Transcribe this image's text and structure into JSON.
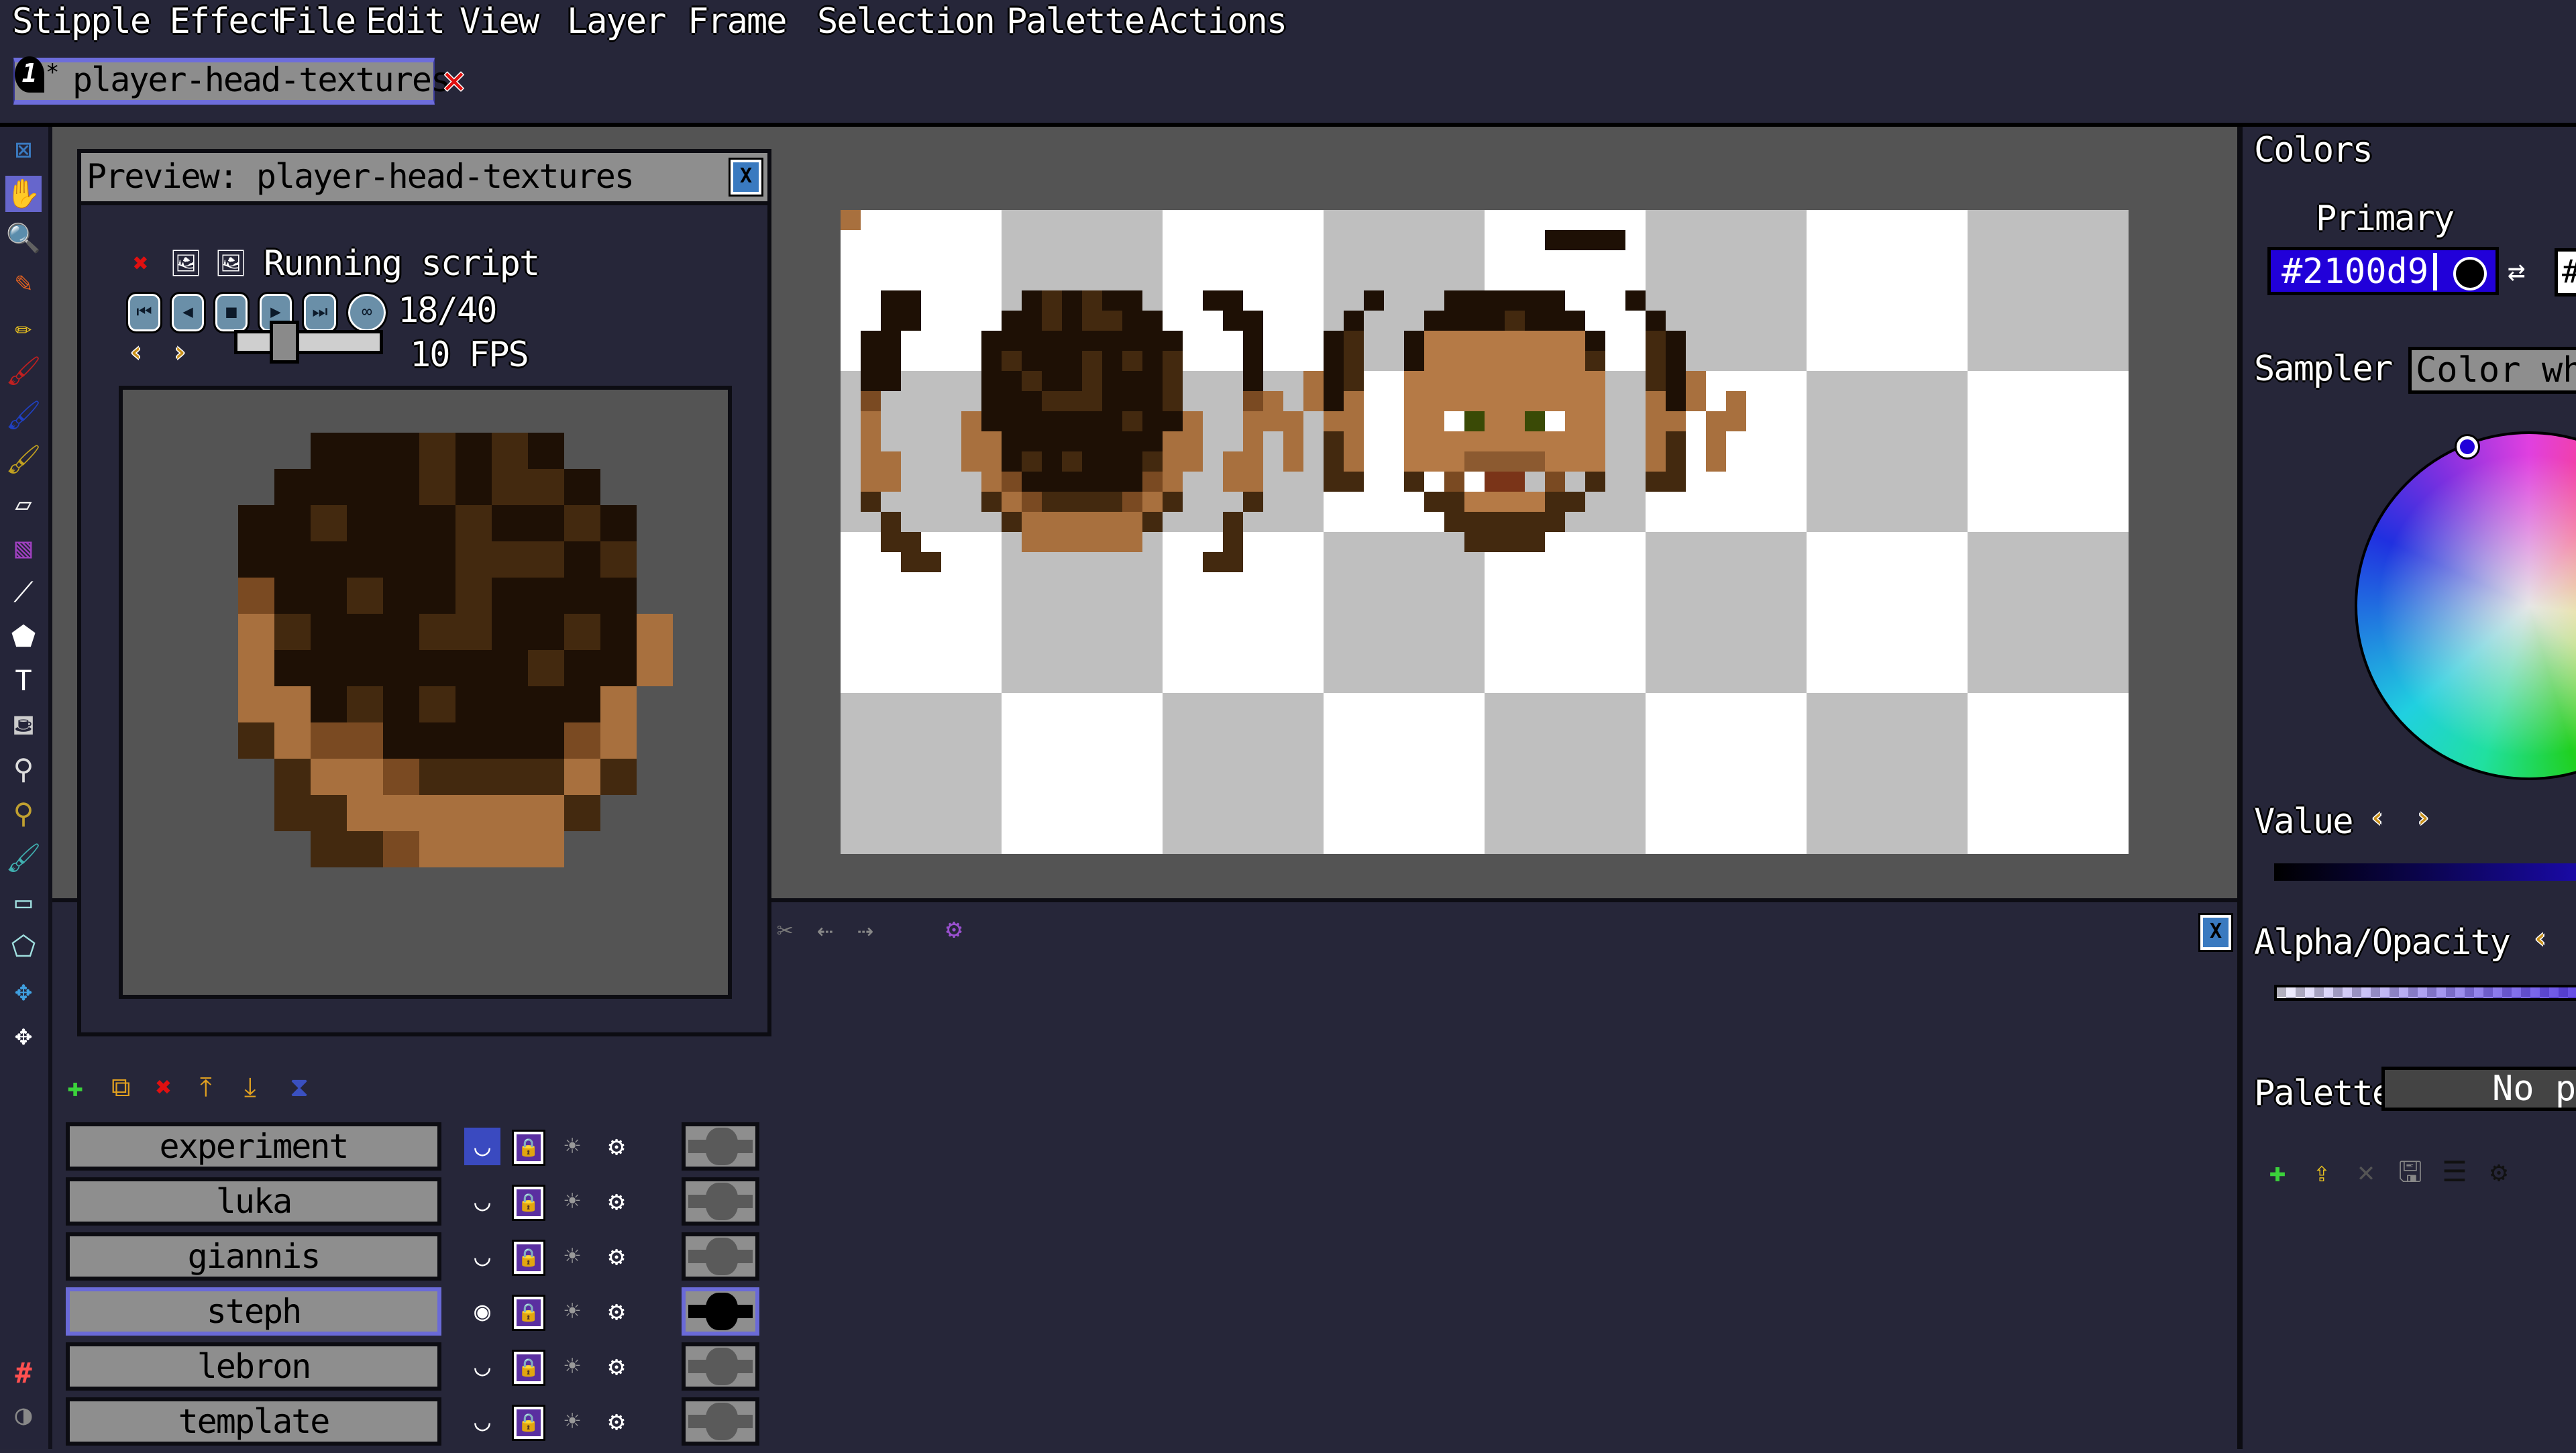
{
  "app": {
    "menu": [
      "Stipple Effect",
      "File",
      "Edit",
      "View",
      "Layer",
      "Frame",
      "Selection",
      "Palette",
      "Actions"
    ]
  },
  "tab": {
    "index": "1",
    "unsaved_marker": "*",
    "label": "player-head-textures",
    "close_icon": "close-x-icon"
  },
  "toolbar": {
    "tools": [
      {
        "name": "toggle-panels",
        "icon": "close-panel-icon",
        "glyph": "⊠",
        "selected": false
      },
      {
        "name": "hand",
        "icon": "hand-icon",
        "glyph": "✋",
        "selected": true
      },
      {
        "name": "zoom",
        "icon": "zoom-icon",
        "glyph": "🔍",
        "selected": false
      },
      {
        "name": "stipple",
        "icon": "stipple-pencil-icon",
        "glyph": "✎",
        "selected": false
      },
      {
        "name": "pencil",
        "icon": "pencil-icon",
        "glyph": "✏",
        "selected": false
      },
      {
        "name": "brush",
        "icon": "brush-icon",
        "glyph": "🖌",
        "selected": false
      },
      {
        "name": "shade-brush",
        "icon": "shade-brush-icon",
        "glyph": "🖌",
        "selected": false
      },
      {
        "name": "script-brush",
        "icon": "script-brush-icon",
        "glyph": "🖌",
        "selected": false
      },
      {
        "name": "eraser",
        "icon": "eraser-icon",
        "glyph": "▱",
        "selected": false
      },
      {
        "name": "gradient",
        "icon": "gradient-icon",
        "glyph": "▧",
        "selected": false
      },
      {
        "name": "line",
        "icon": "line-icon",
        "glyph": "⟋",
        "selected": false
      },
      {
        "name": "shape",
        "icon": "shape-icon",
        "glyph": "⬟",
        "selected": false
      },
      {
        "name": "text",
        "icon": "text-icon",
        "glyph": "T",
        "selected": false
      },
      {
        "name": "fill",
        "icon": "fill-bucket-icon",
        "glyph": "⛾",
        "selected": false
      },
      {
        "name": "color-picker",
        "icon": "eyedropper-icon",
        "glyph": "⚲",
        "selected": false
      },
      {
        "name": "wand",
        "icon": "wand-icon",
        "glyph": "⚲",
        "selected": false
      },
      {
        "name": "brush-select",
        "icon": "brush-select-icon",
        "glyph": "🖌",
        "selected": false
      },
      {
        "name": "box-select",
        "icon": "box-select-icon",
        "glyph": "▭",
        "selected": false
      },
      {
        "name": "polygon-select",
        "icon": "polygon-select-icon",
        "glyph": "⬠",
        "selected": false
      },
      {
        "name": "move-selection",
        "icon": "move-selection-icon",
        "glyph": "✥",
        "selected": false
      },
      {
        "name": "move-contents",
        "icon": "move-contents-icon",
        "glyph": "✥",
        "selected": false
      }
    ],
    "bottom": [
      {
        "name": "pixel-grid",
        "icon": "grid-icon",
        "glyph": "#"
      },
      {
        "name": "symmetry",
        "icon": "symmetry-icon",
        "glyph": "◑"
      }
    ]
  },
  "preview": {
    "title": "Preview: player-head-textures",
    "script_status": "Running script",
    "frame_counter": "18/40",
    "fps_label": "10 FPS",
    "fps_value": 10,
    "fps_slider_fraction": 0.3
  },
  "timeline": {
    "close_icon": "close-panel-icon"
  },
  "layers": {
    "toolbar": [
      "add-layer-icon",
      "duplicate-layer-icon",
      "remove-layer-icon",
      "move-layer-up-icon",
      "move-layer-down-icon",
      "merge-layers-icon"
    ],
    "items": [
      {
        "name": "experiment",
        "visible": false,
        "selected": false,
        "hovered_visibility": true
      },
      {
        "name": "luka",
        "visible": false,
        "selected": false
      },
      {
        "name": "giannis",
        "visible": false,
        "selected": false
      },
      {
        "name": "steph",
        "visible": true,
        "selected": true
      },
      {
        "name": "lebron",
        "visible": false,
        "selected": false
      },
      {
        "name": "template",
        "visible": false,
        "selected": false
      }
    ]
  },
  "colors": {
    "title": "Colors",
    "primary_label": "Primary",
    "primary_hex": "#2100d9",
    "secondary_hex_visible": "#",
    "sampler_label": "Sampler",
    "sampler_value": "Color whe",
    "value_label": "Value",
    "alpha_label": "Alpha/Opacity",
    "palette_label": "Palette",
    "palette_value": "No pa",
    "palette_tools": [
      "add-palette-icon",
      "import-palette-icon",
      "close-palette-icon",
      "save-palette-icon",
      "sort-palette-icon",
      "palette-settings-icon"
    ],
    "accent": "#2100d9",
    "selection_accent": "#6a6ad8"
  }
}
